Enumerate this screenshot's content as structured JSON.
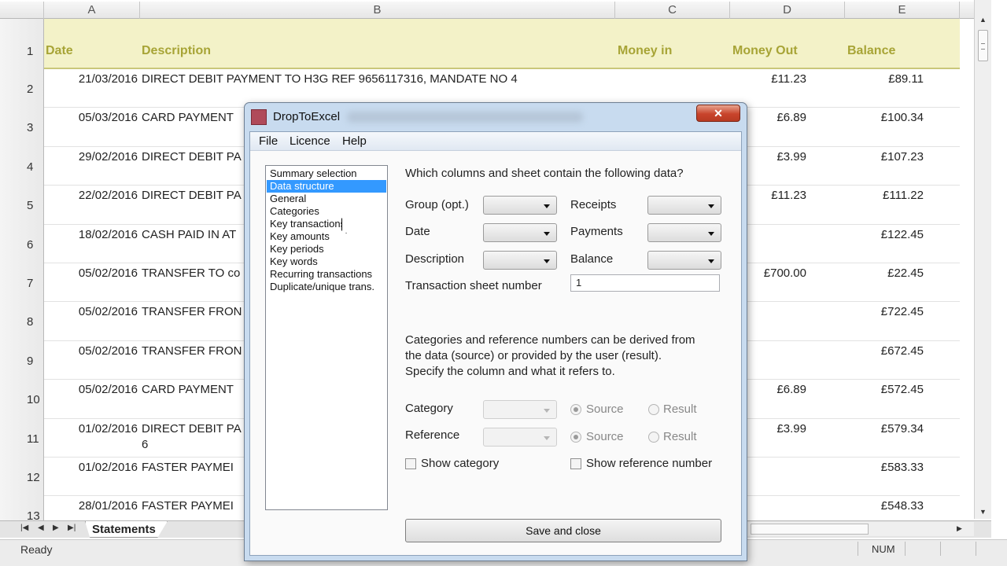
{
  "spreadsheet": {
    "columns": [
      "A",
      "B",
      "C",
      "D",
      "E"
    ],
    "header_row_num": "1",
    "headers": {
      "date": "Date",
      "description": "Description",
      "money_in": "Money in",
      "money_out": "Money Out",
      "balance": "Balance"
    },
    "rows": [
      {
        "num": "2",
        "date": "21/03/2016",
        "desc": "DIRECT DEBIT PAYMENT TO H3G REF 9656117316, MANDATE NO 4",
        "desc2": "",
        "money_in": "",
        "money_out": "£11.23",
        "balance": "£89.11"
      },
      {
        "num": "3",
        "date": "05/03/2016",
        "desc": "CARD PAYMENT",
        "desc2": "",
        "money_in": "",
        "money_out": "£6.89",
        "balance": "£100.34"
      },
      {
        "num": "4",
        "date": "29/02/2016",
        "desc": "DIRECT DEBIT PA",
        "desc2": "",
        "money_in": "",
        "money_out": "£3.99",
        "balance": "£107.23"
      },
      {
        "num": "5",
        "date": "22/02/2016",
        "desc": "DIRECT DEBIT PA",
        "desc2": "",
        "money_in": "",
        "money_out": "£11.23",
        "balance": "£111.22"
      },
      {
        "num": "6",
        "date": "18/02/2016",
        "desc": "CASH PAID IN AT",
        "desc2": "",
        "money_in": "",
        "money_out": "",
        "balance": "£122.45"
      },
      {
        "num": "7",
        "date": "05/02/2016",
        "desc": "TRANSFER TO co",
        "desc2": "",
        "money_in": "",
        "money_out": "£700.00",
        "balance": "£22.45"
      },
      {
        "num": "8",
        "date": "05/02/2016",
        "desc": "TRANSFER FRON",
        "desc2": "",
        "money_in": "",
        "money_out": "",
        "balance": "£722.45"
      },
      {
        "num": "9",
        "date": "05/02/2016",
        "desc": "TRANSFER FRON",
        "desc2": "",
        "money_in": "",
        "money_out": "",
        "balance": "£672.45"
      },
      {
        "num": "10",
        "date": "05/02/2016",
        "desc": "CARD PAYMENT",
        "desc2": "",
        "money_in": "",
        "money_out": "£6.89",
        "balance": "£572.45"
      },
      {
        "num": "11",
        "date": "01/02/2016",
        "desc": "DIRECT DEBIT PA",
        "desc2": "6",
        "money_in": "",
        "money_out": "£3.99",
        "balance": "£579.34"
      },
      {
        "num": "12",
        "date": "01/02/2016",
        "desc": "FASTER PAYMEI",
        "desc2": "",
        "money_in": "",
        "money_out": "",
        "balance": "£583.33"
      },
      {
        "num": "13",
        "date": "28/01/2016",
        "desc": "FASTER PAYMEI",
        "desc2": "",
        "money_in": "",
        "money_out": "",
        "balance": "£548.33"
      }
    ],
    "sheet_tab": "Statements",
    "status_ready": "Ready",
    "status_num": "NUM"
  },
  "dialog": {
    "title": "DropToExcel",
    "close_label": "✕",
    "menu": {
      "file": "File",
      "licence": "Licence",
      "help": "Help"
    },
    "nav_items": [
      "Summary selection",
      "Data structure",
      "General",
      "Categories",
      "Key transactions",
      "Key amounts",
      "Key periods",
      "Key words",
      "Recurring transactions",
      "Duplicate/unique trans."
    ],
    "selected_nav_index": 1,
    "question": "Which columns and sheet contain the following data?",
    "fields": {
      "group": "Group (opt.)",
      "date": "Date",
      "description": "Description",
      "receipts": "Receipts",
      "payments": "Payments",
      "balance": "Balance",
      "sheet_number_label": "Transaction sheet number",
      "sheet_number_value": "1"
    },
    "info_line1": "Categories and reference numbers can be derived from",
    "info_line2": "the data (source) or provided by the user (result).",
    "info_line3": "Specify the column and what it refers to.",
    "category_label": "Category",
    "reference_label": "Reference",
    "source_label": "Source",
    "result_label": "Result",
    "show_category": "Show category",
    "show_reference": "Show reference number",
    "save_button": "Save and close"
  }
}
